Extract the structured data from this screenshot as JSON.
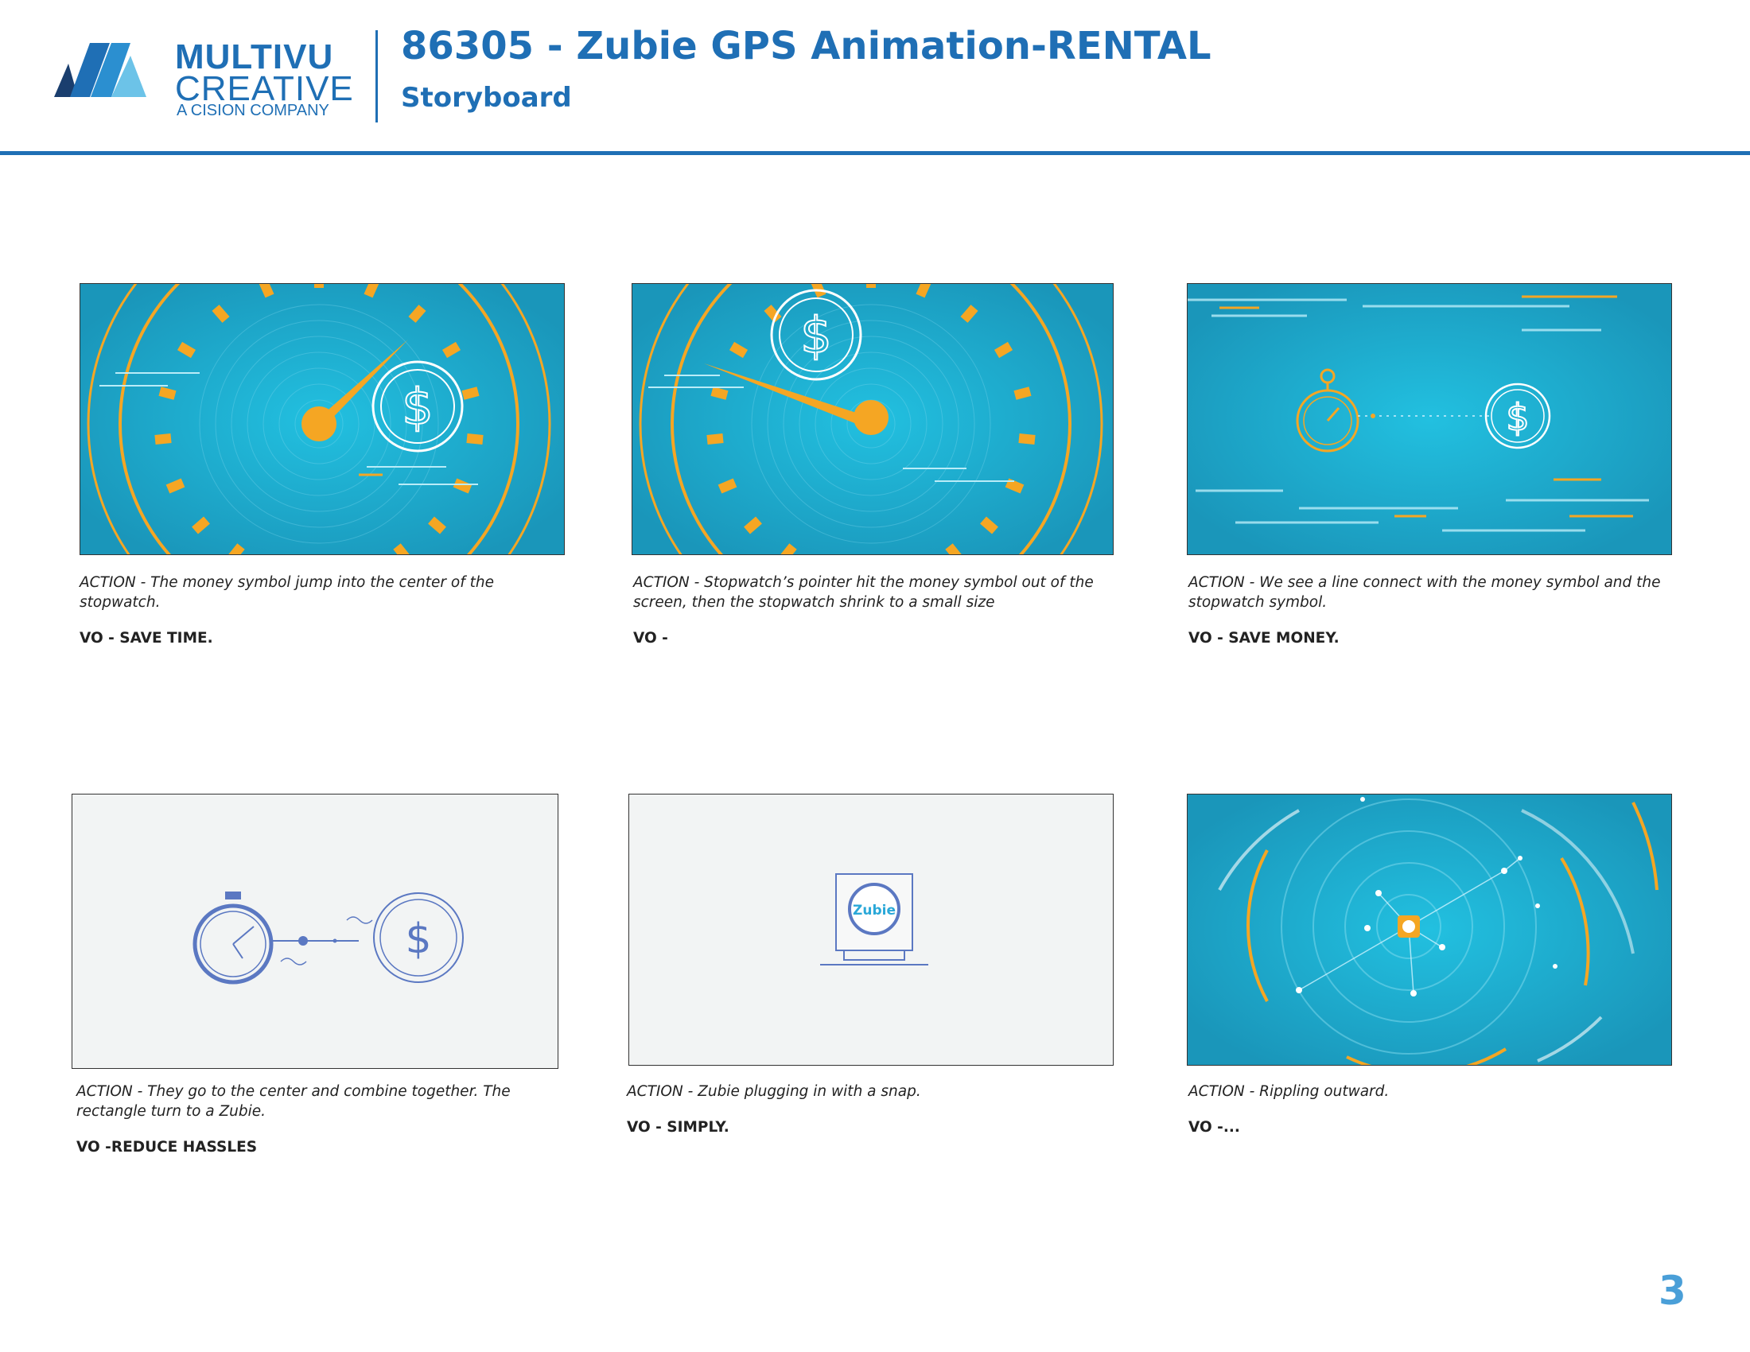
{
  "header": {
    "logo": {
      "line1": "MULTIVU",
      "line2": "CREATIVE",
      "line3": "A CISION COMPANY"
    },
    "title": "86305 - Zubie GPS Animation-RENTAL",
    "subtitle": "Storyboard"
  },
  "colors": {
    "brand_blue": "#1f6fb5",
    "teal": "#1ba6c7",
    "orange": "#f5a623",
    "panel_gray": "#f2f4f4",
    "line_blue": "#5b78c2"
  },
  "frames": [
    {
      "action": "ACTION - The money symbol jump into the center of the stopwatch.",
      "vo": "VO - SAVE TIME."
    },
    {
      "action": "ACTION - Stopwatch’s pointer hit the money symbol out of the screen, then the stopwatch shrink to a small size",
      "vo": "VO -"
    },
    {
      "action": "ACTION - We see a line connect with the money symbol and the stopwatch symbol.",
      "vo": "VO - SAVE MONEY."
    },
    {
      "action": "ACTION -  They go to the center and combine together. The rectangle turn to a Zubie.",
      "vo": "VO -REDUCE HASSLES"
    },
    {
      "action": "ACTION - Zubie plugging in with a snap.",
      "vo": "VO -  SIMPLY."
    },
    {
      "action": "ACTION -  Rippling outward.",
      "vo": "VO -..."
    }
  ],
  "frame_art": {
    "dollar": "$",
    "zubie_label": "Zubie"
  },
  "page_number": "3"
}
